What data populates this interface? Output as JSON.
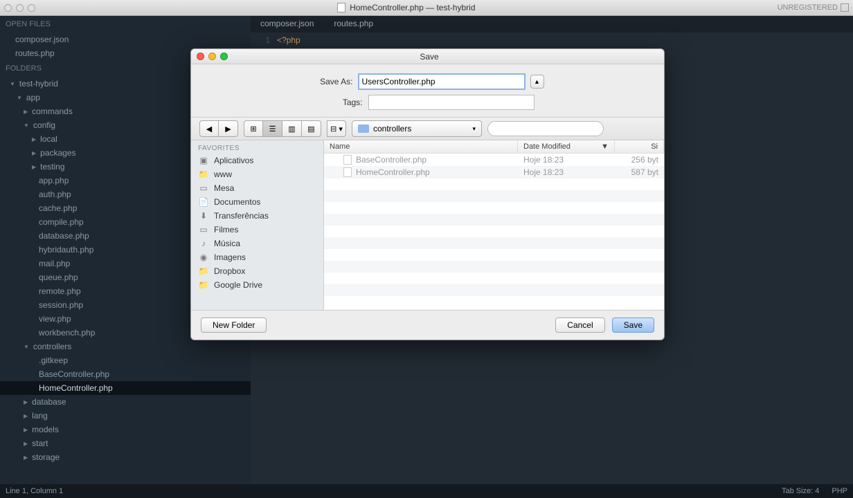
{
  "window": {
    "title": "HomeController.php — test-hybrid",
    "unregistered": "UNREGISTERED"
  },
  "sidebar": {
    "open_files_label": "OPEN FILES",
    "open_files": [
      "composer.json",
      "routes.php"
    ],
    "folders_label": "FOLDERS",
    "root": "test-hybrid",
    "tree": {
      "app": "app",
      "app_children": [
        "commands",
        "config"
      ],
      "config_children_folders": [
        "local",
        "packages",
        "testing"
      ],
      "config_children_files": [
        "app.php",
        "auth.php",
        "cache.php",
        "compile.php",
        "database.php",
        "hybridauth.php",
        "mail.php",
        "queue.php",
        "remote.php",
        "session.php",
        "view.php",
        "workbench.php"
      ],
      "controllers": "controllers",
      "controllers_files": [
        ".gitkeep",
        "BaseController.php",
        "HomeController.php"
      ],
      "after_controllers": [
        "database",
        "lang",
        "models",
        "start",
        "storage"
      ]
    }
  },
  "tabs": [
    "composer.json",
    "routes.php"
  ],
  "code": {
    "line_num": "1",
    "content": "<?php"
  },
  "statusbar": {
    "pos": "Line 1, Column 1",
    "tab": "Tab Size: 4",
    "lang": "PHP"
  },
  "dialog": {
    "title": "Save",
    "save_as_label": "Save As:",
    "save_as_value": "UsersController.php",
    "tags_label": "Tags:",
    "location": "controllers",
    "favorites_label": "FAVORITES",
    "favorites": [
      "Aplicativos",
      "www",
      "Mesa",
      "Documentos",
      "Transferências",
      "Filmes",
      "Música",
      "Imagens",
      "Dropbox",
      "Google Drive"
    ],
    "columns": {
      "name": "Name",
      "date": "Date Modified",
      "size": "Si"
    },
    "files": [
      {
        "name": "BaseController.php",
        "date": "Hoje 18:23",
        "size": "256 byt"
      },
      {
        "name": "HomeController.php",
        "date": "Hoje 18:23",
        "size": "587 byt"
      }
    ],
    "buttons": {
      "new_folder": "New Folder",
      "cancel": "Cancel",
      "save": "Save"
    }
  }
}
